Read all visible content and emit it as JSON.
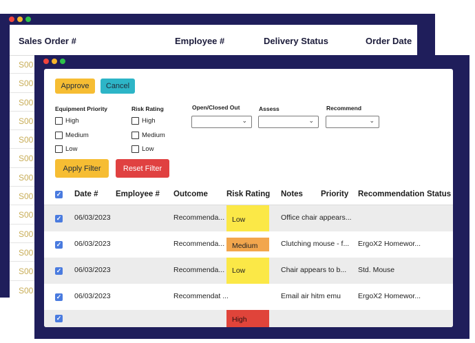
{
  "back_window": {
    "columns": [
      "Sales Order #",
      "Employee #",
      "Delivery Status",
      "Order Date"
    ],
    "rows": [
      "S00",
      "S00",
      "S00",
      "S00",
      "S00",
      "S00",
      "S00",
      "S00",
      "S00",
      "S00",
      "S00",
      "S00",
      "S00"
    ]
  },
  "toolbar": {
    "approve_label": "Approve",
    "cancel_label": "Cancel"
  },
  "filters": {
    "equipment_priority": {
      "title": "Equipment Priority",
      "options": [
        "High",
        "Medium",
        "Low"
      ]
    },
    "risk_rating": {
      "title": "Risk Rating",
      "options": [
        "High",
        "Medium",
        "Low"
      ]
    },
    "open_closed": {
      "title": "Open/Closed Out",
      "value": ""
    },
    "assess": {
      "title": "Assess",
      "value": ""
    },
    "recommend": {
      "title": "Recommend",
      "value": ""
    },
    "apply_label": "Apply Filter",
    "reset_label": "Reset Filter"
  },
  "table": {
    "columns": [
      "Date #",
      "Employee #",
      "Outcome",
      "Risk Rating",
      "Notes",
      "Priority",
      "Recommendation",
      "Status"
    ],
    "rows": [
      {
        "date": "06/03/2023",
        "employee": "",
        "outcome": "Recommenda...",
        "risk": "Low",
        "notes": "Office chair appears...",
        "recommendation": ""
      },
      {
        "date": "06/03/2023",
        "employee": "",
        "outcome": "Recommenda...",
        "risk": "Medium",
        "notes": "Clutching mouse - f...",
        "recommendation": "ErgoX2 Homewor..."
      },
      {
        "date": "06/03/2023",
        "employee": "",
        "outcome": "Recommenda...",
        "risk": "Low",
        "notes": "Chair appears to b...",
        "recommendation": "Std. Mouse"
      },
      {
        "date": "06/03/2023",
        "employee": "",
        "outcome": "Recommendat ...",
        "risk": "",
        "notes": "Email air hitm emu",
        "recommendation": "ErgoX2 Homewor..."
      },
      {
        "date": "",
        "employee": "",
        "outcome": "",
        "risk": "High",
        "notes": "",
        "recommendation": ""
      }
    ]
  },
  "colors": {
    "window_frame": "#1f1e5b",
    "approve": "#f6bd33",
    "cancel": "#2db5c7",
    "reset": "#e04141",
    "risk_low": "#fbe847",
    "risk_medium": "#f2a64d",
    "risk_high": "#e0443a",
    "checkbox": "#4a7bdf"
  }
}
